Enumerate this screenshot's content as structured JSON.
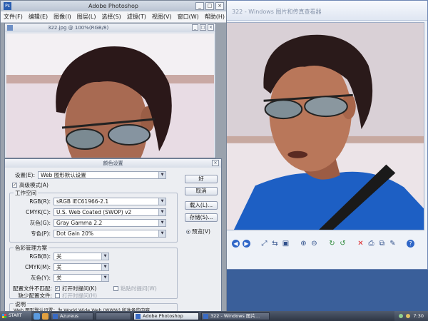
{
  "photoshop": {
    "logo": "Ps",
    "title": "Adobe Photoshop",
    "menu": [
      "文件(F)",
      "编辑(E)",
      "图像(I)",
      "图层(L)",
      "选择(S)",
      "滤镜(T)",
      "视图(V)",
      "窗口(W)",
      "帮助(H)"
    ],
    "window_buttons": [
      "_",
      "□",
      "×"
    ],
    "document": {
      "title": "322.jpg @ 100%(RGB/8)",
      "buttons": [
        "_",
        "□",
        "×"
      ]
    }
  },
  "viewer": {
    "title": "322 - Windows 图片和传真查看器"
  },
  "dialog": {
    "title": "颜色设置",
    "close": "×",
    "settings_label": "设置(E):",
    "settings_value": "Web 图形默认设置",
    "advanced_label": "高级模式(A)",
    "advanced_checked": true,
    "working_space": {
      "label": "工作空间",
      "rows": [
        {
          "label": "RGB(R):",
          "value": "sRGB IEC61966-2.1"
        },
        {
          "label": "CMYK(C):",
          "value": "U.S. Web Coated (SWOP) v2"
        },
        {
          "label": "灰色(G):",
          "value": "Gray Gamma 2.2"
        },
        {
          "label": "专色(P):",
          "value": "Dot Gain 20%"
        }
      ]
    },
    "color_management": {
      "label": "色彩管理方案",
      "rows": [
        {
          "label": "RGB(B):",
          "value": "关"
        },
        {
          "label": "CMYK(M):",
          "value": "关"
        },
        {
          "label": "灰色(Y):",
          "value": "关"
        }
      ],
      "mismatch_label": "配置文件不匹配:",
      "ask_open": "打开时提问(K)",
      "ask_paste": "粘贴时提问(W)",
      "missing_label": "缺少配置文件:",
      "missing_ask_open": "打开时提问(H)"
    },
    "description": {
      "label": "说明",
      "text": "Web 图形默认设置：为 World Wide Web (WWW) 所准备的内容"
    },
    "buttons": {
      "ok": "好",
      "cancel": "取消",
      "load": "载入(L)...",
      "save": "存储(S)...",
      "preview": "预览(V)"
    }
  },
  "taskbar": {
    "start": "START",
    "tasks": [
      "Azureus",
      "Adobe Photoshop",
      "322 - Windows 图片..."
    ],
    "clock": "7:30"
  },
  "colors": {
    "desktop": "#3a5f9a",
    "shirt": "#1d5fc4",
    "hair": "#2a1a1a",
    "skin": "#b9775a",
    "wall": "#e8dce4"
  }
}
